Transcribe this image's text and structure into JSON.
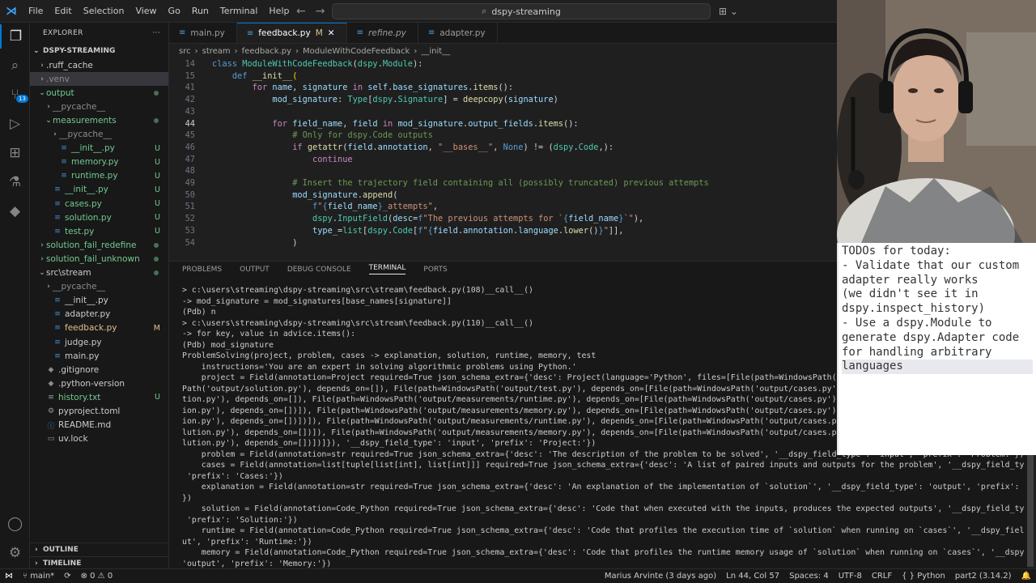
{
  "menu": [
    "File",
    "Edit",
    "Selection",
    "View",
    "Go",
    "Run",
    "Terminal",
    "Help"
  ],
  "search": {
    "text": "dspy-streaming"
  },
  "activity": {
    "scm_badge": "13"
  },
  "explorer": {
    "title": "EXPLORER",
    "more": "···",
    "root": "DSPY-STREAMING",
    "items": [
      {
        "name": ".ruff_cache",
        "arrow": "›",
        "indent": 1,
        "color": "normal",
        "status": ""
      },
      {
        "name": ".venv",
        "arrow": "›",
        "indent": 1,
        "color": "dim",
        "status": "",
        "selected": true
      },
      {
        "name": "output",
        "arrow": "⌄",
        "indent": 1,
        "color": "green",
        "status": "dot"
      },
      {
        "name": "__pycache__",
        "arrow": "›",
        "indent": 2,
        "color": "dim",
        "status": ""
      },
      {
        "name": "measurements",
        "arrow": "⌄",
        "indent": 2,
        "color": "green",
        "status": "dot"
      },
      {
        "name": "__pycache__",
        "arrow": "›",
        "indent": 3,
        "color": "dim",
        "status": ""
      },
      {
        "name": "__init__.py",
        "arrow": "",
        "indent": 3,
        "color": "green",
        "status": "U"
      },
      {
        "name": "memory.py",
        "arrow": "",
        "indent": 3,
        "color": "green",
        "status": "U"
      },
      {
        "name": "runtime.py",
        "arrow": "",
        "indent": 3,
        "color": "green",
        "status": "U"
      },
      {
        "name": "__init__.py",
        "arrow": "",
        "indent": 2,
        "color": "green",
        "status": "U"
      },
      {
        "name": "cases.py",
        "arrow": "",
        "indent": 2,
        "color": "green",
        "status": "U"
      },
      {
        "name": "solution.py",
        "arrow": "",
        "indent": 2,
        "color": "green",
        "status": "U"
      },
      {
        "name": "test.py",
        "arrow": "",
        "indent": 2,
        "color": "green",
        "status": "U"
      },
      {
        "name": "solution_fail_redefine",
        "arrow": "›",
        "indent": 1,
        "color": "green",
        "status": "dot"
      },
      {
        "name": "solution_fail_unknown",
        "arrow": "›",
        "indent": 1,
        "color": "green",
        "status": "dot"
      },
      {
        "name": "src\\stream",
        "arrow": "⌄",
        "indent": 1,
        "color": "normal",
        "status": "dot"
      },
      {
        "name": "__pycache__",
        "arrow": "›",
        "indent": 2,
        "color": "dim",
        "status": ""
      },
      {
        "name": "__init__.py",
        "arrow": "",
        "indent": 2,
        "color": "normal",
        "status": ""
      },
      {
        "name": "adapter.py",
        "arrow": "",
        "indent": 2,
        "color": "normal",
        "status": ""
      },
      {
        "name": "feedback.py",
        "arrow": "",
        "indent": 2,
        "color": "mod",
        "status": "M"
      },
      {
        "name": "judge.py",
        "arrow": "",
        "indent": 2,
        "color": "normal",
        "status": ""
      },
      {
        "name": "main.py",
        "arrow": "",
        "indent": 2,
        "color": "normal",
        "status": ""
      },
      {
        "name": ".gitignore",
        "arrow": "",
        "indent": 1,
        "color": "normal",
        "status": ""
      },
      {
        "name": ".python-version",
        "arrow": "",
        "indent": 1,
        "color": "normal",
        "status": ""
      },
      {
        "name": "history.txt",
        "arrow": "",
        "indent": 1,
        "color": "green",
        "status": "U"
      },
      {
        "name": "pyproject.toml",
        "arrow": "",
        "indent": 1,
        "color": "normal",
        "status": ""
      },
      {
        "name": "README.md",
        "arrow": "",
        "indent": 1,
        "color": "normal",
        "status": ""
      },
      {
        "name": "uv.lock",
        "arrow": "",
        "indent": 1,
        "color": "normal",
        "status": ""
      }
    ],
    "outline": "OUTLINE",
    "timeline": "TIMELINE"
  },
  "tabs": [
    {
      "label": "main.py",
      "active": false,
      "modified": "",
      "italic": false
    },
    {
      "label": "feedback.py",
      "active": true,
      "modified": "M",
      "italic": false
    },
    {
      "label": "refine.py",
      "active": false,
      "modified": "",
      "italic": true
    },
    {
      "label": "adapter.py",
      "active": false,
      "modified": "",
      "italic": false
    }
  ],
  "breadcrumb": [
    "src",
    "stream",
    "feedback.py",
    "ModuleWithCodeFeedback",
    "__init__"
  ],
  "code": [
    {
      "n": "14",
      "cur": false,
      "html": "<span class=\"kb\">class</span> <span class=\"cls\">ModuleWithCodeFeedback</span><span class=\"tx\">(</span><span class=\"cls\">dspy</span><span class=\"tx\">.</span><span class=\"cls\">Module</span><span class=\"tx\">):</span>"
    },
    {
      "n": "15",
      "cur": false,
      "html": "    <span class=\"kb\">def</span> <span class=\"fn\">__init__</span><span class=\"br\">(</span>"
    },
    {
      "n": "41",
      "cur": false,
      "html": "        <span class=\"kw\">for</span> <span class=\"vr\">name</span><span class=\"tx\">, </span><span class=\"vr\">signature</span> <span class=\"kw\">in</span> <span class=\"vr\">self</span><span class=\"tx\">.</span><span class=\"vr\">base_signatures</span><span class=\"tx\">.</span><span class=\"fn\">items</span><span class=\"tx\">():</span>"
    },
    {
      "n": "42",
      "cur": false,
      "html": "            <span class=\"vr\">mod_signature</span><span class=\"tx\">: </span><span class=\"cls\">Type</span><span class=\"tx\">[</span><span class=\"cls\">dspy</span><span class=\"tx\">.</span><span class=\"cls\">Signature</span><span class=\"tx\">] = </span><span class=\"fn\">deepcopy</span><span class=\"tx\">(</span><span class=\"vr\">signature</span><span class=\"tx\">)</span>"
    },
    {
      "n": "43",
      "cur": false,
      "html": ""
    },
    {
      "n": "44",
      "cur": true,
      "html": "            <span class=\"kw\">for</span> <span class=\"vr\">field_name</span><span class=\"tx\">, </span><span class=\"vr\">field</span> <span class=\"kw\">in</span> <span class=\"vr\">mod_signature</span><span class=\"tx\">.</span><span class=\"vr\">output_fields</span><span class=\"tx\">.</span><span class=\"fn\">items</span><span class=\"tx\">():</span>"
    },
    {
      "n": "45",
      "cur": false,
      "html": "                <span class=\"cm\"># Only for dspy.Code outputs</span>"
    },
    {
      "n": "46",
      "cur": false,
      "html": "                <span class=\"kw\">if</span> <span class=\"fn\">getattr</span><span class=\"tx\">(</span><span class=\"vr\">field</span><span class=\"tx\">.</span><span class=\"vr\">annotation</span><span class=\"tx\">, </span><span class=\"str\">\"__bases__\"</span><span class=\"tx\">, </span><span class=\"kb\">None</span><span class=\"tx\">) != (</span><span class=\"cls\">dspy</span><span class=\"tx\">.</span><span class=\"cls\">Code</span><span class=\"tx\">,):</span>"
    },
    {
      "n": "47",
      "cur": false,
      "html": "                    <span class=\"kw\">continue</span>"
    },
    {
      "n": "48",
      "cur": false,
      "html": ""
    },
    {
      "n": "49",
      "cur": false,
      "html": "                <span class=\"cm\"># Insert the trajectory field containing all (possibly truncated) previous attempts</span>"
    },
    {
      "n": "50",
      "cur": false,
      "html": "                <span class=\"vr\">mod_signature</span><span class=\"tx\">.</span><span class=\"fn\">append</span><span class=\"tx\">(</span>"
    },
    {
      "n": "51",
      "cur": false,
      "html": "                    <span class=\"kb\">f</span><span class=\"str\">\"</span><span class=\"kb\">{</span><span class=\"vr\">field_name</span><span class=\"kb\">}</span><span class=\"str\">_attempts\"</span><span class=\"tx\">,</span>"
    },
    {
      "n": "52",
      "cur": false,
      "html": "                    <span class=\"cls\">dspy</span><span class=\"tx\">.</span><span class=\"cls\">InputField</span><span class=\"tx\">(</span><span class=\"vr\">desc</span><span class=\"tx\">=</span><span class=\"kb\">f</span><span class=\"str\">\"The previous attempts for `</span><span class=\"kb\">{</span><span class=\"vr\">field_name</span><span class=\"kb\">}</span><span class=\"str\">`\"</span><span class=\"tx\">),</span>"
    },
    {
      "n": "53",
      "cur": false,
      "html": "                    <span class=\"vr\">type_</span><span class=\"tx\">=</span><span class=\"cls\">list</span><span class=\"tx\">[</span><span class=\"cls\">dspy</span><span class=\"tx\">.</span><span class=\"cls\">Code</span><span class=\"tx\">[</span><span class=\"kb\">f</span><span class=\"str\">\"</span><span class=\"kb\">{</span><span class=\"vr\">field</span><span class=\"tx\">.</span><span class=\"vr\">annotation</span><span class=\"tx\">.</span><span class=\"vr\">language</span><span class=\"tx\">.</span><span class=\"fn\">lower</span><span class=\"tx\">()</span><span class=\"kb\">}</span><span class=\"str\">\"</span><span class=\"tx\">]],</span>"
    },
    {
      "n": "54",
      "cur": false,
      "html": "                <span class=\"tx\">)</span>"
    }
  ],
  "panel": {
    "tabs": [
      "PROBLEMS",
      "OUTPUT",
      "DEBUG CONSOLE",
      "TERMINAL",
      "PORTS"
    ],
    "active": "TERMINAL"
  },
  "terminal": [
    "> c:\\users\\streaming\\dspy-streaming\\src\\stream\\feedback.py(108)__call__()",
    "-> mod_signature = mod_signatures[base_names[signature]]",
    "(Pdb) n",
    "> c:\\users\\streaming\\dspy-streaming\\src\\stream\\feedback.py(110)__call__()",
    "-> for key, value in advice.items():",
    "(Pdb) mod_signature",
    "ProblemSolving(project, problem, cases -> explanation, solution, runtime, memory, test",
    "    instructions='You are an expert in solving algorithmic problems using Python.'",
    "    project = Field(annotation=Project required=True json_schema_extra={'desc': Project(language='Python', files=[File(path=WindowsPath('output/cases",
    "Path('output/solution.py'), depends_on=[]), File(path=WindowsPath('output/test.py'), depends_on=[File(path=WindowsPath('output/cases.py'), depends_o",
    "tion.py'), depends_on=[]), File(path=WindowsPath('output/measurements/runtime.py'), depends_on=[File(path=WindowsPath('output/cases.py'), depends_o",
    "ion.py'), depends_on=[])]), File(path=WindowsPath('output/measurements/memory.py'), depends_on=[File(path=WindowsPath('output/cases.py'), depends_o",
    "ion.py'), depends_on=[])])]), File(path=WindowsPath('output/measurements/runtime.py'), depends_on=[File(path=WindowsPath('output/cases.py'), depend",
    "lution.py'), depends_on=[])]), File(path=WindowsPath('output/measurements/memory.py'), depends_on=[File(path=WindowsPath('output/cases.py'), depend",
    "lution.py'), depends_on=[])])]}), '__dspy_field_type': 'input', 'prefix': 'Project:'})",
    "    problem = Field(annotation=str required=True json_schema_extra={'desc': 'The description of the problem to be solved', '__dspy_field_type': 'input', 'prefix': 'Problem:'})",
    "    cases = Field(annotation=list[tuple[list[int], list[int]]] required=True json_schema_extra={'desc': 'A list of paired inputs and outputs for the problem', '__dspy_field_type': 'input',",
    " 'prefix': 'Cases:'})",
    "    explanation = Field(annotation=str required=True json_schema_extra={'desc': 'An explanation of the implementation of `solution`', '__dspy_field_type': 'output', 'prefix': 'Explanation:'",
    "})",
    "    solution = Field(annotation=Code_Python required=True json_schema_extra={'desc': 'Code that when executed with the inputs, produces the expected outputs', '__dspy_field_type': 'output',",
    " 'prefix': 'Solution:'})",
    "    runtime = Field(annotation=Code_Python required=True json_schema_extra={'desc': 'Code that profiles the execution time of `solution` when running on `cases`', '__dspy_field_type': 'outp",
    "ut', 'prefix': 'Runtime:'})",
    "    memory = Field(annotation=Code_Python required=True json_schema_extra={'desc': 'Code that profiles the runtime memory usage of `solution` when running on `cases`', '__dspy_field_type':",
    "'output', 'prefix': 'Memory:'})"
  ],
  "status": {
    "branch": "main*",
    "problems": "⊗ 0 ⚠ 0",
    "blame": "Marius Arvinte (3 days ago)",
    "position": "Ln 44, Col 57",
    "spaces": "Spaces: 4",
    "encoding": "UTF-8",
    "eol": "CRLF",
    "language": "{ } Python",
    "interpreter": "part2 (3.14.2)"
  },
  "todo": [
    "TODOs for today:",
    "- Validate that our custom",
    "adapter really works",
    "(we didn't see it in",
    "dspy.inspect_history)",
    "- Use a dspy.Module to",
    "generate dspy.Adapter code",
    "for handling arbitrary",
    "languages"
  ],
  "colors": {
    "accent": "#0078d4",
    "untracked": "#73c991",
    "modified": "#e2c08d"
  }
}
